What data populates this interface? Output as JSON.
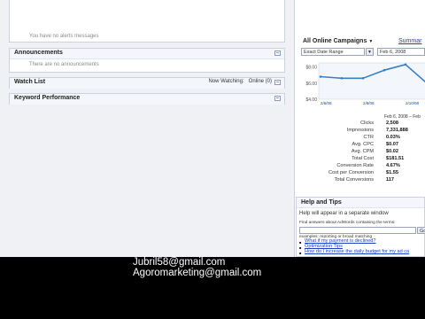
{
  "status_messages": {
    "text": "You have no alerts messages"
  },
  "announcements": {
    "title": "Announcements",
    "empty_text": "There are no announcements"
  },
  "watch_list": {
    "title": "Watch List",
    "now_watching_label": "Now Watching:",
    "now_watching_value": "Online (0)"
  },
  "keyword_performance": {
    "title": "Keyword Performance"
  },
  "campaigns": {
    "selected": "All Online Campaigns",
    "summary_link": "Summar",
    "date_range": "Exact Date Range",
    "start_date": "Feb 6, 2008"
  },
  "chart_data": {
    "type": "line",
    "x": [
      "2/6/08",
      "2/8/08",
      "2/10/08",
      "2/12/08",
      "2/14/08",
      "2/16/08"
    ],
    "x_tick_labels": [
      "2/6/08",
      "2/8/08",
      "2/10/08",
      "2/"
    ],
    "y_tick_labels": [
      "$8.00",
      "$6.00",
      "$4.00"
    ],
    "series": [
      {
        "values": [
          6.8,
          6.6,
          6.6,
          7.6,
          8.3,
          6.0
        ]
      }
    ],
    "ylim": [
      4,
      8.5
    ],
    "color": "#3a7fc4"
  },
  "stats": {
    "range_label": "Feb 6, 2008 – Feb",
    "rows": [
      {
        "label": "Clicks",
        "value": "2,508"
      },
      {
        "label": "Impressions",
        "value": "7,331,888"
      },
      {
        "label": "CTR",
        "value": "0.03%"
      },
      {
        "label": "Avg. CPC",
        "value": "$0.07"
      },
      {
        "label": "Avg. CPM",
        "value": "$0.02"
      },
      {
        "label": "Total Cost",
        "value": "$181.51"
      },
      {
        "label": "Conversion Rate",
        "value": "4.67%"
      },
      {
        "label": "Cost per Conversion",
        "value": "$1.55"
      },
      {
        "label": "Total Conversions",
        "value": "117"
      }
    ]
  },
  "help": {
    "title": "Help and Tips",
    "subtitle": "Help will appear in a separate window",
    "search_hint": "Find answers about AdWords containing the terms:",
    "search_button": "Go",
    "examples": "examples: reporting or broad matching",
    "links": [
      "What if my payment is declined?",
      "Optimization Tips",
      "How do I increase the daily budget for my ad ca"
    ]
  },
  "caption": {
    "line1": "Jubril58@gmail.com",
    "line2": "Agoromarketing@gmail.com"
  }
}
